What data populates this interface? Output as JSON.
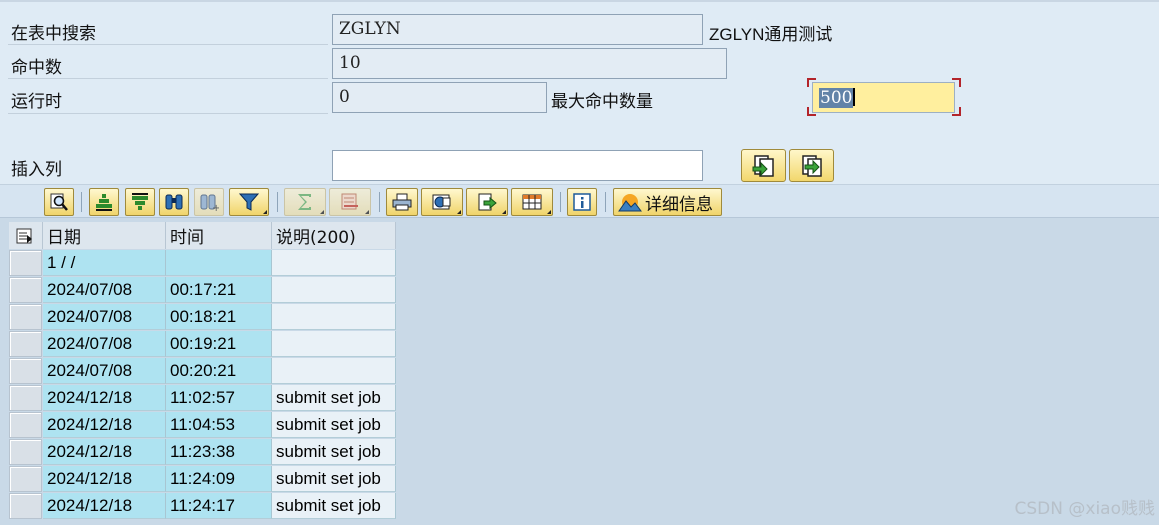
{
  "form": {
    "search_table_label": "在表中搜索",
    "search_table_value": "ZGLYN",
    "search_table_desc": "ZGLYN通用测试",
    "hits_label": "命中数",
    "hits_value": "10",
    "runtime_label": "运行时",
    "runtime_value": "0",
    "max_hits_label": "最大命中数量",
    "max_hits_value": "500",
    "insert_col_label": "插入列",
    "insert_col_value": ""
  },
  "toolbar": {
    "details_label": "详细信息",
    "icons": [
      "details-magnifier-icon",
      "sort-ascending-icon",
      "sort-descending-icon",
      "find-binoculars-icon",
      "find-next-icon",
      "filter-icon",
      "sum-icon",
      "subtotal-icon",
      "print-icon",
      "views-icon",
      "export-icon",
      "layout-icon",
      "info-icon",
      "details-icon"
    ]
  },
  "table": {
    "columns": [
      "日期",
      "时间",
      "说明(200)"
    ],
    "rows": [
      {
        "date": "1  /  /",
        "time": "",
        "desc": ""
      },
      {
        "date": "2024/07/08",
        "time": "00:17:21",
        "desc": ""
      },
      {
        "date": "2024/07/08",
        "time": "00:18:21",
        "desc": ""
      },
      {
        "date": "2024/07/08",
        "time": "00:19:21",
        "desc": ""
      },
      {
        "date": "2024/07/08",
        "time": "00:20:21",
        "desc": ""
      },
      {
        "date": "2024/12/18",
        "time": "11:02:57",
        "desc": "submit set job"
      },
      {
        "date": "2024/12/18",
        "time": "11:04:53",
        "desc": "submit set job"
      },
      {
        "date": "2024/12/18",
        "time": "11:23:38",
        "desc": "submit set job"
      },
      {
        "date": "2024/12/18",
        "time": "11:24:09",
        "desc": "submit set job"
      },
      {
        "date": "2024/12/18",
        "time": "11:24:17",
        "desc": "submit set job"
      }
    ]
  },
  "watermark": "CSDN @xiao贱贱",
  "colors": {
    "key_cell": "#aee3f1",
    "active_field": "#ffef9e",
    "focus_corner": "#b3242a"
  }
}
